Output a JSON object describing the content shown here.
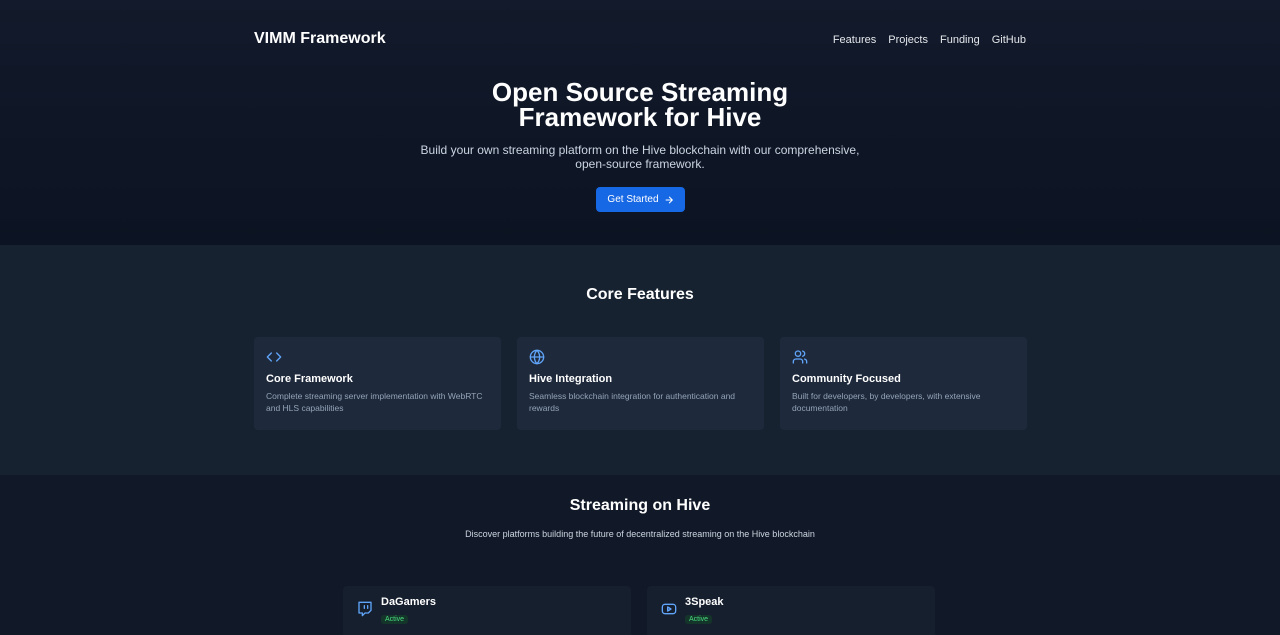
{
  "brand": "VIMM Framework",
  "nav": {
    "items": [
      "Features",
      "Projects",
      "Funding",
      "GitHub"
    ]
  },
  "hero": {
    "title_line1": "Open Source Streaming",
    "title_line2": "Framework for Hive",
    "subtitle_line1": "Build your own streaming platform on the Hive blockchain with our comprehensive,",
    "subtitle_line2": "open-source framework.",
    "cta_label": "Get Started",
    "cta_icon": "arrow-right-icon"
  },
  "features": {
    "title": "Core Features",
    "cards": [
      {
        "icon": "code-icon",
        "title": "Core Framework",
        "description": "Complete streaming server implementation with WebRTC and HLS capabilities"
      },
      {
        "icon": "globe-icon",
        "title": "Hive Integration",
        "description": "Seamless blockchain integration for authentication and rewards"
      },
      {
        "icon": "users-icon",
        "title": "Community Focused",
        "description": "Built for developers, by developers, with extensive documentation"
      }
    ]
  },
  "streaming": {
    "title": "Streaming on Hive",
    "subtitle": "Discover platforms building the future of decentralized streaming on the Hive blockchain",
    "platforms": [
      {
        "icon": "twitch-icon",
        "name": "DaGamers",
        "status": "Active"
      },
      {
        "icon": "youtube-icon",
        "name": "3Speak",
        "status": "Active"
      }
    ]
  },
  "colors": {
    "accent": "#1768e5",
    "icon": "#60a5fa",
    "status": "#4ade80"
  }
}
